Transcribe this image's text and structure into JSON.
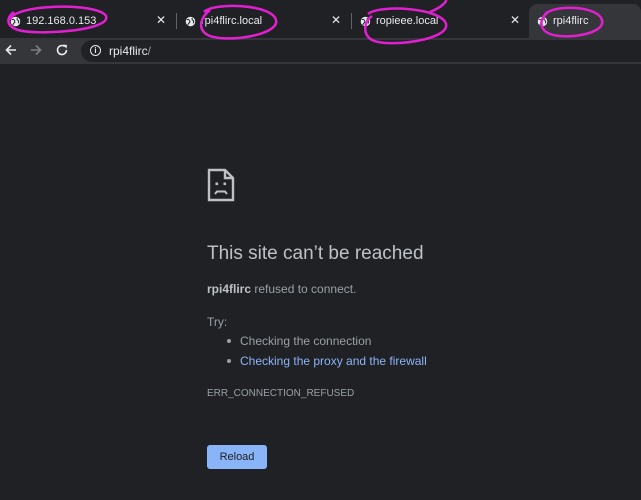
{
  "tabs": [
    {
      "title": "192.168.0.153",
      "close": "✕",
      "active": false
    },
    {
      "title": "rpi4flirc.local",
      "close": "✕",
      "active": false
    },
    {
      "title": "ropieee.local",
      "close": "✕",
      "active": false
    },
    {
      "title": "rpi4flirc",
      "close": "",
      "active": true
    }
  ],
  "toolbar": {
    "back_icon": "arrow-left-icon",
    "forward_icon": "arrow-right-icon",
    "reload_icon": "reload-icon",
    "info_icon": "info-icon",
    "url_host": "rpi4flirc",
    "url_path": "/"
  },
  "error_page": {
    "icon": "sad-page-icon",
    "headline": "This site can’t be reached",
    "host": "rpi4flirc",
    "description_rest": " refused to connect.",
    "try_label": "Try:",
    "suggestions": [
      {
        "text": "Checking the connection",
        "is_link": false
      },
      {
        "text": "Checking the proxy and the firewall",
        "is_link": true
      }
    ],
    "error_code": "ERR_CONNECTION_REFUSED",
    "reload_label": "Reload"
  },
  "colors": {
    "background": "#202124",
    "toolbar": "#35363a",
    "link": "#8ab4f8",
    "annotation": "#e020d0"
  }
}
